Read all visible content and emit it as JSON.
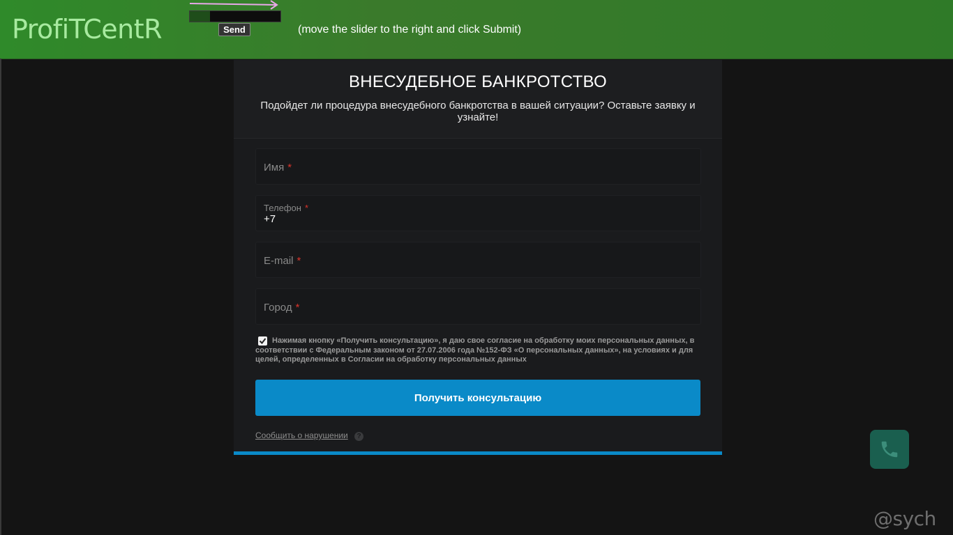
{
  "topbar": {
    "logo": "ProfiTCentR",
    "send_label": "Send",
    "hint": "(move the slider to the right and click Submit)",
    "slider_progress": 0.22
  },
  "form": {
    "title": "ВНЕСУДЕБНОЕ БАНКРОТСТВО",
    "subtitle": "Подойдет ли процедура внесудебного банкротства в вашей ситуации? Оставьте заявку и узнайте!",
    "fields": [
      {
        "label": "Имя",
        "required": "*",
        "value": ""
      },
      {
        "label": "Телефон",
        "required": "*",
        "value": "+7"
      },
      {
        "label": "E-mail",
        "required": "*",
        "value": ""
      },
      {
        "label": "Город",
        "required": "*",
        "value": ""
      }
    ],
    "consent_checked": true,
    "consent_text": "Нажимая кнопку «Получить консультацию», я даю свое согласие на обработку моих персональных данных, в соответствии с Федеральным законом от 27.07.2006 года №152-ФЗ «О персональных данных», на условиях и для целей, определенных в Согласии на обработку персональных данных",
    "submit_label": "Получить консультацию",
    "report_label": "Сообщить о нарушении",
    "help_icon": "?"
  },
  "watermark": "@sych",
  "colors": {
    "topbar_green": "#2f8a2a",
    "accent_blue": "#0a8ac8",
    "phone_button": "#1a5f4f",
    "required_red": "#d9342b"
  },
  "icons": {
    "phone": "phone-icon",
    "slider_arrow": "arrow-right-icon",
    "checkbox": "checkmark-icon"
  }
}
